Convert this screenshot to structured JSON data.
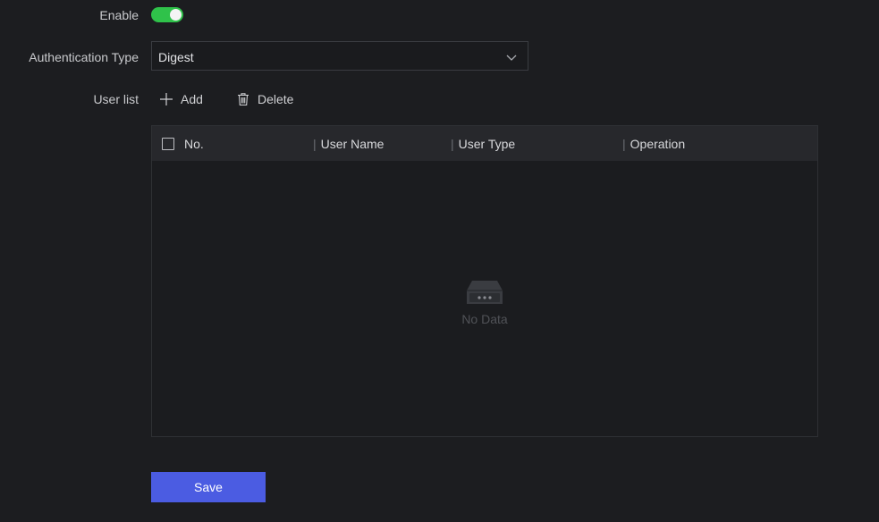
{
  "form": {
    "enable_label": "Enable",
    "enable_on": true,
    "auth_label": "Authentication Type",
    "auth_value": "Digest",
    "userlist_label": "User list"
  },
  "toolbar": {
    "add_label": "Add",
    "delete_label": "Delete"
  },
  "table": {
    "columns": [
      "No.",
      "User Name",
      "User Type",
      "Operation"
    ],
    "rows": [],
    "empty_text": "No Data"
  },
  "actions": {
    "save_label": "Save"
  },
  "colors": {
    "background": "#1c1d20",
    "toggle_on": "#2fc24a",
    "primary": "#4b5ce2"
  },
  "icons": {
    "add": "plus-icon",
    "delete": "trash-icon",
    "dropdown": "chevron-down-icon",
    "empty": "empty-box-icon"
  }
}
